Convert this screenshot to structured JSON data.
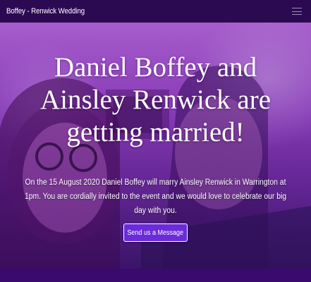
{
  "navbar": {
    "brand": "Boffey - Renwick Wedding",
    "menu_icon": "hamburger-menu-icon"
  },
  "hero": {
    "headline": "Daniel Boffey and Ainsley Renwick are getting married!",
    "intro": "On the 15 August 2020 Daniel Boffey will marry Ainsley Renwick in Warrington at 1pm. You are cordially invited to the event and we would love to celebrate our big day with you.",
    "cta_label": "Send us a Message"
  },
  "colors": {
    "navbar": "#2c0a52",
    "hero_tint": "#9b48c9",
    "button": "#6b2bd9",
    "footer_band": "#3a0a6e"
  }
}
